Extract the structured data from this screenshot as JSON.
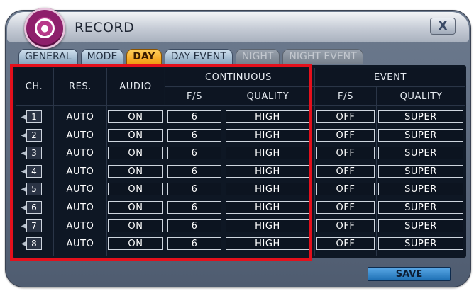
{
  "window": {
    "title": "RECORD",
    "close_label": "X"
  },
  "tabs": [
    {
      "label": "GENERAL",
      "state": "normal"
    },
    {
      "label": "MODE",
      "state": "normal"
    },
    {
      "label": "DAY",
      "state": "active"
    },
    {
      "label": "DAY EVENT",
      "state": "normal"
    },
    {
      "label": "NIGHT",
      "state": "disabled"
    },
    {
      "label": "NIGHT EVENT",
      "state": "disabled"
    }
  ],
  "table": {
    "headers": {
      "ch": "CH.",
      "res": "RES.",
      "audio": "AUDIO",
      "continuous": "CONTINUOUS",
      "event": "EVENT",
      "fs": "F/S",
      "quality": "QUALITY",
      "event_fs": "F/S",
      "event_quality": "QUALITY"
    },
    "rows": [
      {
        "ch": "1",
        "res": "AUTO",
        "audio": "ON",
        "fs": "6",
        "quality": "HIGH",
        "event_fs": "OFF",
        "event_quality": "SUPER"
      },
      {
        "ch": "2",
        "res": "AUTO",
        "audio": "ON",
        "fs": "6",
        "quality": "HIGH",
        "event_fs": "OFF",
        "event_quality": "SUPER"
      },
      {
        "ch": "3",
        "res": "AUTO",
        "audio": "ON",
        "fs": "6",
        "quality": "HIGH",
        "event_fs": "OFF",
        "event_quality": "SUPER"
      },
      {
        "ch": "4",
        "res": "AUTO",
        "audio": "ON",
        "fs": "6",
        "quality": "HIGH",
        "event_fs": "OFF",
        "event_quality": "SUPER"
      },
      {
        "ch": "5",
        "res": "AUTO",
        "audio": "ON",
        "fs": "6",
        "quality": "HIGH",
        "event_fs": "OFF",
        "event_quality": "SUPER"
      },
      {
        "ch": "6",
        "res": "AUTO",
        "audio": "ON",
        "fs": "6",
        "quality": "HIGH",
        "event_fs": "OFF",
        "event_quality": "SUPER"
      },
      {
        "ch": "7",
        "res": "AUTO",
        "audio": "ON",
        "fs": "6",
        "quality": "HIGH",
        "event_fs": "OFF",
        "event_quality": "SUPER"
      },
      {
        "ch": "8",
        "res": "AUTO",
        "audio": "ON",
        "fs": "6",
        "quality": "HIGH",
        "event_fs": "OFF",
        "event_quality": "SUPER"
      }
    ]
  },
  "footer": {
    "save_label": "SAVE"
  },
  "colors": {
    "highlight_border": "#e4101c",
    "active_tab": "#f29a12",
    "save_button": "#1d6fb4"
  },
  "icons": {
    "logo": "film-reel-icon",
    "close": "close-icon",
    "channel": "speaker-icon"
  }
}
